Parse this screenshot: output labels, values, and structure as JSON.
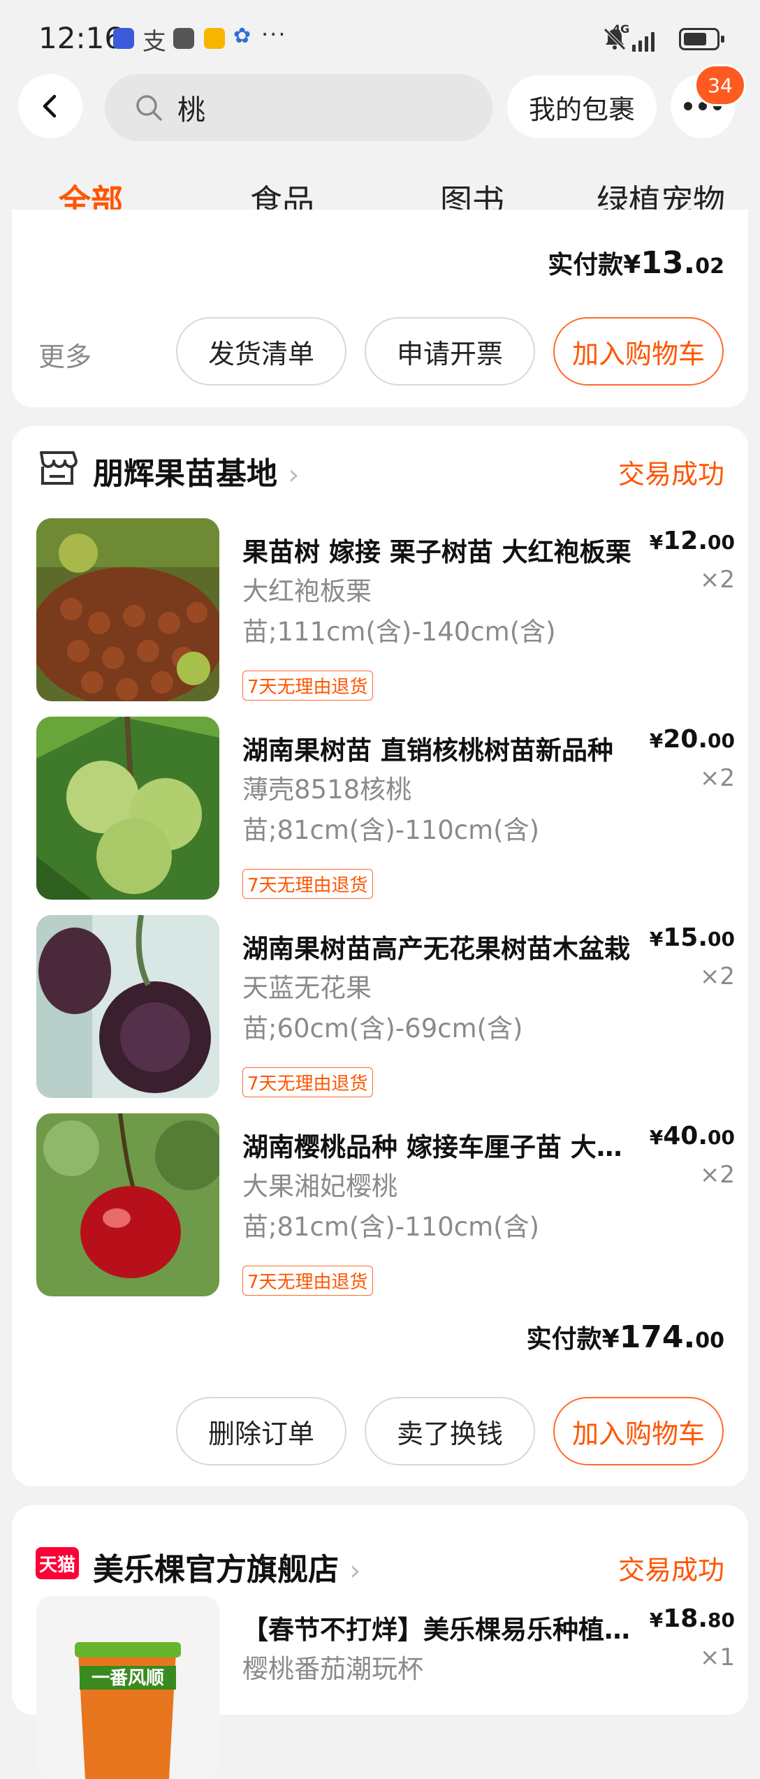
{
  "status_bar": {
    "time": "12:16",
    "dots": "···",
    "network": "4G"
  },
  "nav": {
    "search_query": "桃",
    "my_package": "我的包裹",
    "badge_count": "34"
  },
  "tabs": [
    {
      "label": "全部",
      "active": true
    },
    {
      "label": "食品",
      "active": false
    },
    {
      "label": "图书",
      "active": false
    },
    {
      "label": "绿植宠物",
      "active": false
    }
  ],
  "order1": {
    "total_label": "实付款",
    "currency": "¥",
    "total_int": "13.",
    "total_dec": "02",
    "more_label": "更多",
    "buttons": [
      "发货清单",
      "申请开票",
      "加入购物车"
    ]
  },
  "order2": {
    "store": "朋辉果苗基地",
    "status": "交易成功",
    "items": [
      {
        "title": "果苗树 嫁接 栗子树苗 大红袍板栗",
        "spec1": "大红袍板栗",
        "spec2": "苗;111cm(含)-140cm(含)",
        "tag": "7天无理由退货",
        "price_int": "12.",
        "price_dec": "00",
        "qty": "×2"
      },
      {
        "title": "湖南果树苗 直销核桃树苗新品种",
        "spec1": "薄壳8518核桃",
        "spec2": "苗;81cm(含)-110cm(含)",
        "tag": "7天无理由退货",
        "price_int": "20.",
        "price_dec": "00",
        "qty": "×2"
      },
      {
        "title": "湖南果树苗高产无花果树苗木盆栽",
        "spec1": "天蓝无花果",
        "spec2": "苗;60cm(含)-69cm(含)",
        "tag": "7天无理由退货",
        "price_int": "15.",
        "price_dec": "00",
        "qty": "×2"
      },
      {
        "title": "湖南樱桃品种 嫁接车厘子苗 大樱桃",
        "spec1": "大果湘妃樱桃",
        "spec2": "苗;81cm(含)-110cm(含)",
        "tag": "7天无理由退货",
        "price_int": "40.",
        "price_dec": "00",
        "qty": "×2"
      }
    ],
    "total_label": "实付款",
    "currency": "¥",
    "total_int": "174.",
    "total_dec": "00",
    "buttons": [
      "删除订单",
      "卖了换钱",
      "加入购物车"
    ]
  },
  "order3": {
    "store_badge": "天猫",
    "store": "美乐棵官方旗舰店",
    "status": "交易成功",
    "item": {
      "title": "【春节不打烊】美乐棵易乐种植盆栽",
      "spec1": "樱桃番茄潮玩杯",
      "price_int": "18.",
      "price_dec": "80",
      "qty": "×1",
      "cup_text": "一番风顺"
    }
  },
  "colors": {
    "accent": "#ff5500",
    "tmall_red": "#ff0036"
  }
}
